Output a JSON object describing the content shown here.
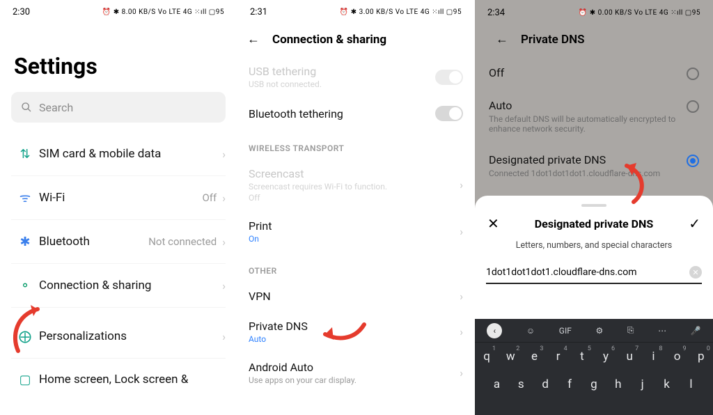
{
  "phone1": {
    "status": {
      "time": "2:30",
      "right": "⏰ ✱ 8.00 KB/S  Vo LTE  4G ⁙ıll  ▢95"
    },
    "title": "Settings",
    "search_placeholder": "Search",
    "items": [
      {
        "icon": "⇅",
        "label": "SIM card & mobile data",
        "value": ""
      },
      {
        "icon": "ᯤ",
        "label": "Wi-Fi",
        "value": "Off"
      },
      {
        "icon": "✱",
        "label": "Bluetooth",
        "value": "Not connected"
      },
      {
        "icon": "⚬",
        "label": "Connection & sharing",
        "value": ""
      },
      {
        "icon": "⨁",
        "label": "Personalizations",
        "value": ""
      },
      {
        "icon": "▢",
        "label": "Home screen, Lock screen &",
        "value": ""
      }
    ]
  },
  "phone2": {
    "status": {
      "time": "2:31",
      "right": "⏰ ✱ 3.00 KB/S  Vo LTE  4G ⁙ıll  ▢95"
    },
    "header": "Connection & sharing",
    "usb": {
      "title": "USB tethering",
      "sub": "USB not connected."
    },
    "bt_tether": "Bluetooth tethering",
    "sec_wireless": "WIRELESS TRANSPORT",
    "screencast": {
      "title": "Screencast",
      "sub": "Screencast requires Wi-Fi to function.",
      "sub2": "Off"
    },
    "print": {
      "title": "Print",
      "sub": "On"
    },
    "sec_other": "OTHER",
    "vpn": "VPN",
    "pdns": {
      "title": "Private DNS",
      "sub": "Auto"
    },
    "aauto": {
      "title": "Android Auto",
      "sub": "Use apps on your car display."
    }
  },
  "phone3": {
    "status": {
      "time": "2:34",
      "right": "⏰ ✱ 0.00 KB/S  Vo LTE  4G ⁙ıll  ▢95"
    },
    "header": "Private DNS",
    "opt_off": "Off",
    "opt_auto": {
      "t": "Auto",
      "s": "The default DNS will be automatically encrypted to enhance network security."
    },
    "opt_des": {
      "t": "Designated private DNS",
      "s": "Connected 1dot1dot1dot1.cloudflare-dns.com"
    },
    "sheet_title": "Designated private DNS",
    "hint": "Letters, numbers, and special characters",
    "field_value": "1dot1dot1dot1.cloudflare-dns.com",
    "kb_top": {
      "gif": "GIF"
    },
    "kb_row1": [
      "q",
      "w",
      "e",
      "r",
      "t",
      "y",
      "u",
      "i",
      "o",
      "p"
    ],
    "kb_row1_sup": [
      "1",
      "2",
      "3",
      "4",
      "5",
      "6",
      "7",
      "8",
      "9",
      "0"
    ],
    "kb_row2": [
      "a",
      "s",
      "d",
      "f",
      "g",
      "h",
      "j",
      "k",
      "l"
    ]
  }
}
